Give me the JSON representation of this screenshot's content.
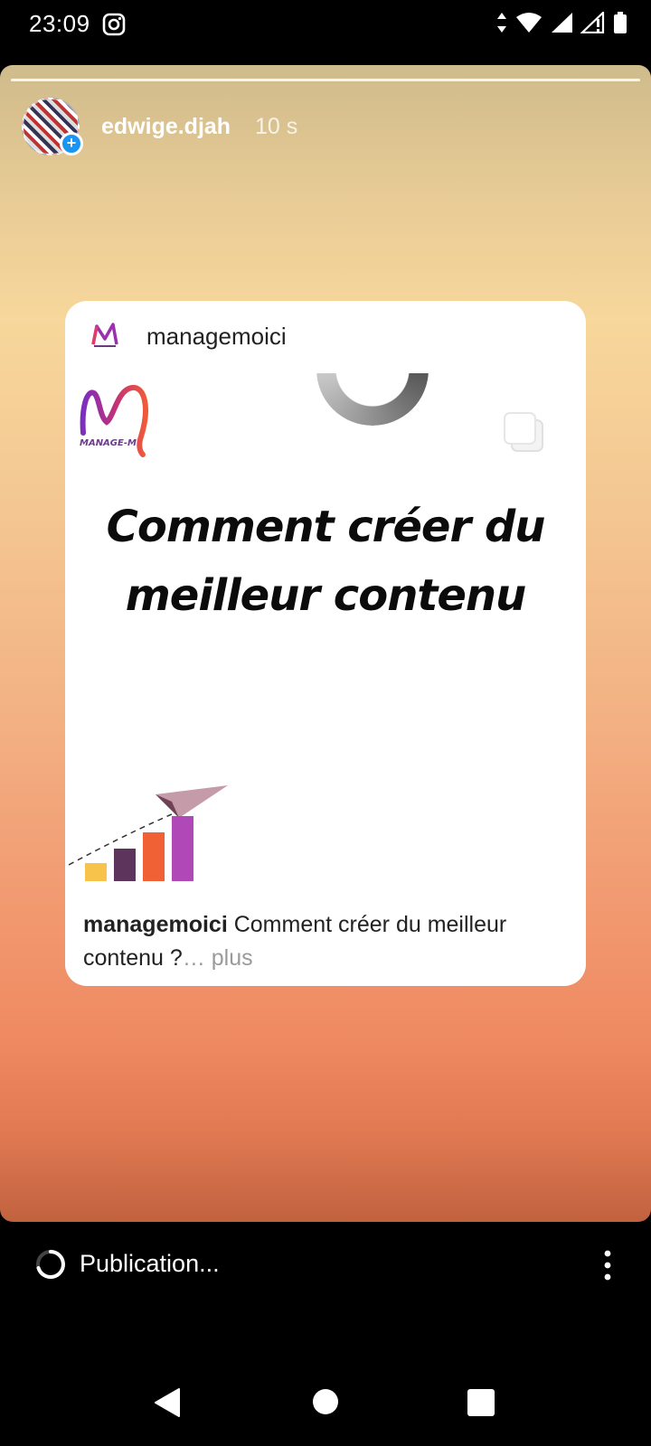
{
  "status_bar": {
    "time": "23:09",
    "icons": [
      "instagram-icon",
      "data-arrows-icon",
      "wifi-icon",
      "signal-icon",
      "signal-no-data-icon",
      "battery-icon"
    ]
  },
  "story": {
    "username": "edwige.djah",
    "time_ago": "10 s"
  },
  "post": {
    "account": "managemoici",
    "logo_text": "MANAGE-M",
    "headline": "Comment créer du meilleur contenu",
    "caption_user": "managemoici",
    "caption_text": " Comment créer du meilleur contenu ?",
    "caption_more": "… plus"
  },
  "bottom": {
    "status": "Publication..."
  },
  "colors": {
    "accent_blue": "#1c95f2",
    "story_top": "#cfbb8b",
    "story_bottom": "#c1623f"
  }
}
